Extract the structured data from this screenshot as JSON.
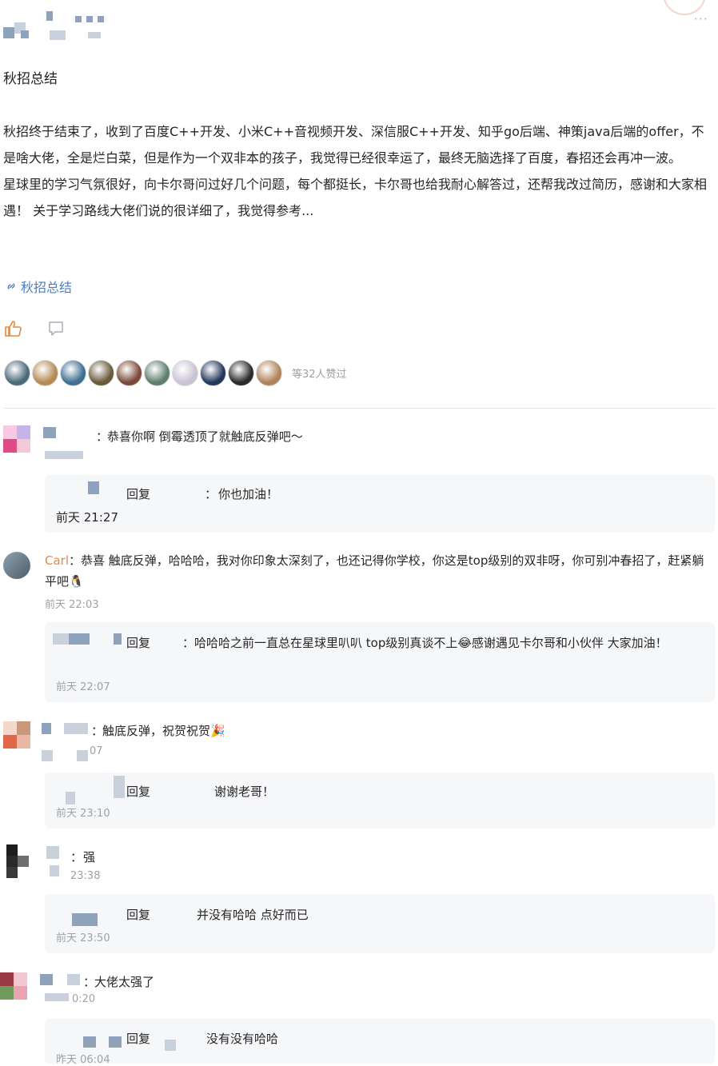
{
  "post": {
    "title": "秋招总结",
    "paragraph1": "秋招终于结束了，收到了百度C++开发、小米C++音视频开发、深信服C++开发、知乎go后端、神策java后端的offer，不是啥大佬，全是烂白菜，但是作为一个双非本的孩子，我觉得已经很幸运了，最终无脑选择了百度，春招还会再冲一波。",
    "paragraph2": "星球里的学习气氛很好，向卡尔哥问过好几个问题，每个都挺长，卡尔哥也给我耐心解答过，还帮我改过简历，感谢和大家相遇！ 关于学习路线大佬们说的很详细了，我觉得参考...",
    "link_label": "秋招总结",
    "more_menu": "···"
  },
  "likes": {
    "count_text": "等32人赞过",
    "avatar_colors": [
      "#4a6a7a",
      "#b58a55",
      "#3f6f93",
      "#6a5a3a",
      "#7a4a3a",
      "#5f7f6f",
      "#c9c3d6",
      "#24385f",
      "#2a2a2a",
      "#b0845a"
    ]
  },
  "comments": [
    {
      "text": "恭喜你啊 倒霉透顶了就触底反弹吧～",
      "reply": {
        "label": "回复",
        "text": "你也加油！",
        "time": "前天 21:27"
      }
    },
    {
      "author": "Carl",
      "text": "恭喜 触底反弹，哈哈哈，我对你印象太深刻了，也还记得你学校，你这是top级别的双非呀，你可别冲春招了，赶紧躺平吧🐧",
      "time": "前天 22:03",
      "reply": {
        "label": "回复",
        "text": "哈哈哈之前一直总在星球里叭叭 top级别真谈不上😂感谢遇见卡尔哥和小伙伴 大家加油！",
        "time": "前天 22:07"
      }
    },
    {
      "text": "触底反弹，祝贺祝贺🎉",
      "time": "07",
      "reply": {
        "label": "回复",
        "text": "谢谢老哥！",
        "time": "前天 23:10"
      }
    },
    {
      "text": "强",
      "time": "23:38",
      "reply": {
        "label": "回复",
        "text": "并没有哈哈 点好而已",
        "time": "前天 23:50"
      }
    },
    {
      "text": "大佬太强了",
      "time": "0:20",
      "reply": {
        "label": "回复",
        "text": "没有没有哈哈",
        "time": "昨天 06:04"
      }
    }
  ],
  "colors": {
    "link": "#4b7fc5",
    "author_highlight": "#e6884a",
    "like_icon": "#e8873b"
  }
}
